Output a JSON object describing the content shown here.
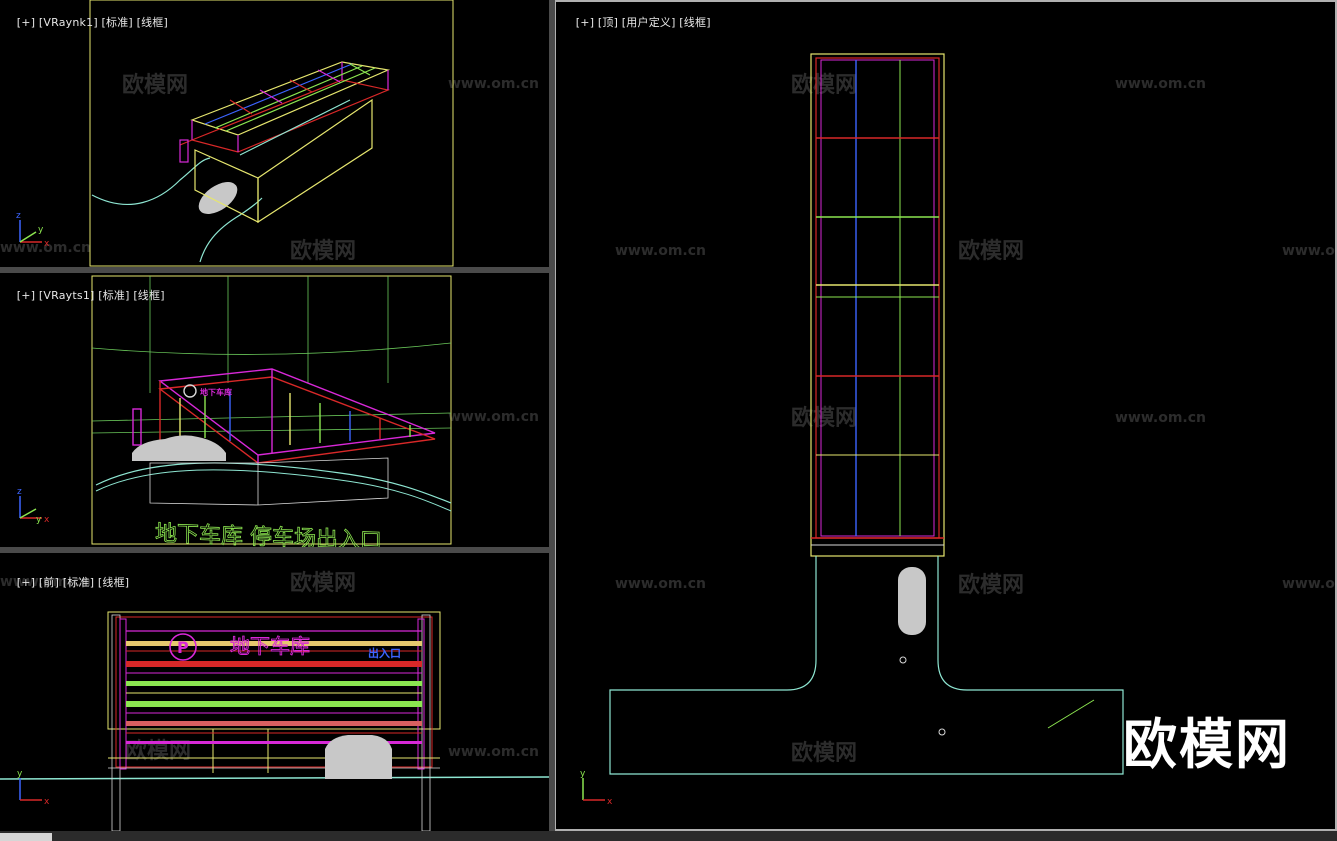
{
  "viewports": {
    "top_left": {
      "label_parts": [
        "[+]",
        "[VRaynk1]",
        "[标准]",
        "[线框]"
      ]
    },
    "mid_left": {
      "label_parts": [
        "[+]",
        "[VRayts1]",
        "[标准]",
        "[线框]"
      ]
    },
    "bottom_left": {
      "label_parts": [
        "[+]",
        "[前]",
        "[标准]",
        "[线框]"
      ]
    },
    "right": {
      "label_parts": [
        "[+]",
        "[顶]",
        "[用户定义]",
        "[线框]"
      ]
    }
  },
  "scene_text": {
    "perspective_sign": "地下车库 停车场出入口",
    "front_sign_main": "地下车库",
    "front_sign_sub": "出入口",
    "front_sign_logo": "P"
  },
  "watermarks": {
    "cn": "欧模网",
    "url": "www.om.cn",
    "big": "欧模网"
  },
  "axis": {
    "x": "x",
    "y": "y",
    "z": "z"
  },
  "colors": {
    "background": "#000000",
    "divider": "#4a4a4a",
    "frame_yellow": "#e6e66e",
    "wire_cyan": "#8ee6d2",
    "wire_red": "#d82828",
    "wire_magenta": "#d828d8",
    "wire_green": "#8ce650",
    "wire_blue": "#3c64ff"
  }
}
